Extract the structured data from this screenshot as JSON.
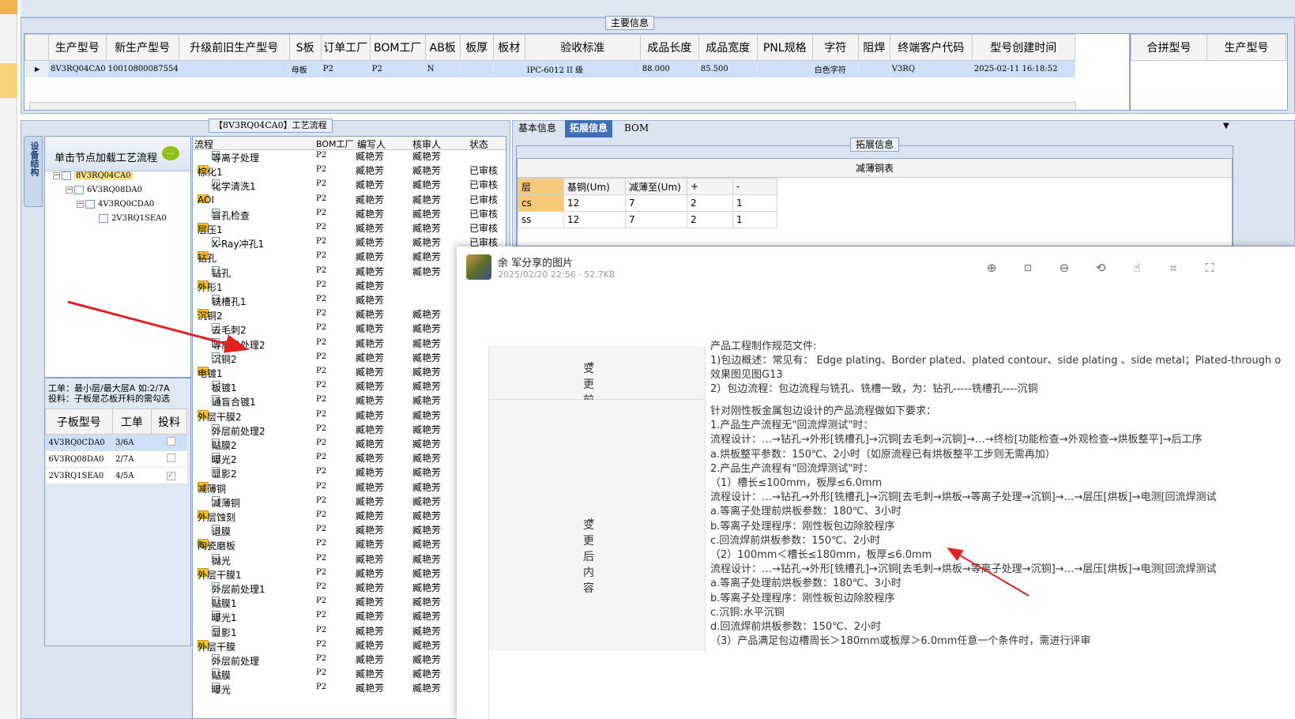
{
  "main_info": {
    "title": "主要信息",
    "columns": [
      "生产型号",
      "新生产型号",
      "升级前旧生产型号",
      "S板",
      "订单工厂",
      "BOM工厂",
      "AB板",
      "板厚",
      "板材",
      "验收标准",
      "成品长度",
      "成品宽度",
      "PNL规格",
      "字符",
      "阻焊",
      "终端客户代码",
      "型号创建时间"
    ],
    "row": [
      "8V3RQ04CA0",
      "10010800087554",
      "",
      "母板",
      "P2",
      "P2",
      "N",
      "",
      "",
      "IPC-6012 II 级",
      "88.000",
      "85.500",
      "",
      "白色字符",
      "",
      "V3RQ",
      "2025-02-11 16:18:52"
    ],
    "side_columns": [
      "合拼型号",
      "生产型号"
    ]
  },
  "process": {
    "title": "【8V3RQ04CA0】工艺流程",
    "side_tab": "设备结构",
    "tree_header": "单击节点加载工艺流程",
    "tree_nodes": [
      "8V3RQ04CA0",
      "6V3RQ08DA0",
      "4V3RQ0CDA0",
      "2V3RQ1SEA0"
    ],
    "info_line1": "工单：最小层/最大层A 如:2/7A",
    "info_line2": "投料：子板是芯板开料的需勾选",
    "sub_columns": [
      "子板型号",
      "工单",
      "投料"
    ],
    "sub_rows": [
      {
        "model": "4V3RQ0CDA0",
        "order": "3/6A",
        "checked": ""
      },
      {
        "model": "6V3RQ08DA0",
        "order": "2/7A",
        "checked": ""
      },
      {
        "model": "2V3RQ1SEA0",
        "order": "4/5A",
        "checked": "✓"
      }
    ],
    "flow_columns": [
      "流程",
      "BOM工厂",
      "编写人",
      "核审人",
      "状态"
    ],
    "flow_rows": [
      {
        "name": "等离子处理",
        "folder": false,
        "factory": "P2",
        "writer": "臧艳芳",
        "reviewer": "臧艳芳",
        "status": ""
      },
      {
        "name": "棕化1",
        "folder": true,
        "factory": "P2",
        "writer": "臧艳芳",
        "reviewer": "臧艳芳",
        "status": "已审核"
      },
      {
        "name": "化学清洗1",
        "folder": false,
        "factory": "P2",
        "writer": "臧艳芳",
        "reviewer": "臧艳芳",
        "status": "已审核"
      },
      {
        "name": "AOI",
        "folder": true,
        "factory": "P2",
        "writer": "臧艳芳",
        "reviewer": "臧艳芳",
        "status": "已审核"
      },
      {
        "name": "盲孔检查",
        "folder": false,
        "factory": "P2",
        "writer": "臧艳芳",
        "reviewer": "臧艳芳",
        "status": "已审核"
      },
      {
        "name": "层压1",
        "folder": true,
        "factory": "P2",
        "writer": "臧艳芳",
        "reviewer": "臧艳芳",
        "status": "已审核"
      },
      {
        "name": "X-Ray冲孔1",
        "folder": false,
        "factory": "P2",
        "writer": "臧艳芳",
        "reviewer": "臧艳芳",
        "status": "已审核"
      },
      {
        "name": "钻孔",
        "folder": true,
        "factory": "P2",
        "writer": "臧艳芳",
        "reviewer": "臧艳芳",
        "status": "已审核"
      },
      {
        "name": "钻孔",
        "folder": false,
        "factory": "P2",
        "writer": "臧艳芳",
        "reviewer": "臧艳芳",
        "status": "已审核"
      },
      {
        "name": "外形1",
        "folder": true,
        "factory": "P2",
        "writer": "臧艳芳",
        "reviewer": "",
        "status": ""
      },
      {
        "name": "铣槽孔1",
        "folder": false,
        "factory": "P2",
        "writer": "臧艳芳",
        "reviewer": "",
        "status": ""
      },
      {
        "name": "沉铜2",
        "folder": true,
        "factory": "P2",
        "writer": "臧艳芳",
        "reviewer": "臧艳芳",
        "status": ""
      },
      {
        "name": "去毛刺2",
        "folder": false,
        "factory": "P2",
        "writer": "臧艳芳",
        "reviewer": "臧艳芳",
        "status": ""
      },
      {
        "name": "等离子处理2",
        "folder": false,
        "factory": "P2",
        "writer": "臧艳芳",
        "reviewer": "臧艳芳",
        "status": ""
      },
      {
        "name": "沉铜2",
        "folder": false,
        "factory": "P2",
        "writer": "臧艳芳",
        "reviewer": "臧艳芳",
        "status": ""
      },
      {
        "name": "电镀1",
        "folder": true,
        "factory": "P2",
        "writer": "臧艳芳",
        "reviewer": "臧艳芳",
        "status": ""
      },
      {
        "name": "板镀1",
        "folder": false,
        "factory": "P2",
        "writer": "臧艳芳",
        "reviewer": "臧艳芳",
        "status": ""
      },
      {
        "name": "通盲合镀1",
        "folder": false,
        "factory": "P2",
        "writer": "臧艳芳",
        "reviewer": "臧艳芳",
        "status": ""
      },
      {
        "name": "外层干膜2",
        "folder": true,
        "factory": "P2",
        "writer": "臧艳芳",
        "reviewer": "臧艳芳",
        "status": ""
      },
      {
        "name": "外层前处理2",
        "folder": false,
        "factory": "P2",
        "writer": "臧艳芳",
        "reviewer": "臧艳芳",
        "status": ""
      },
      {
        "name": "贴膜2",
        "folder": false,
        "factory": "P2",
        "writer": "臧艳芳",
        "reviewer": "臧艳芳",
        "status": ""
      },
      {
        "name": "曝光2",
        "folder": false,
        "factory": "P2",
        "writer": "臧艳芳",
        "reviewer": "臧艳芳",
        "status": ""
      },
      {
        "name": "显影2",
        "folder": false,
        "factory": "P2",
        "writer": "臧艳芳",
        "reviewer": "臧艳芳",
        "status": ""
      },
      {
        "name": "减薄铜",
        "folder": true,
        "factory": "P2",
        "writer": "臧艳芳",
        "reviewer": "臧艳芳",
        "status": ""
      },
      {
        "name": "减薄铜",
        "folder": false,
        "factory": "P2",
        "writer": "臧艳芳",
        "reviewer": "臧艳芳",
        "status": ""
      },
      {
        "name": "外层蚀刻",
        "folder": true,
        "factory": "P2",
        "writer": "臧艳芳",
        "reviewer": "臧艳芳",
        "status": ""
      },
      {
        "name": "退膜",
        "folder": false,
        "factory": "P2",
        "writer": "臧艳芳",
        "reviewer": "臧艳芳",
        "status": ""
      },
      {
        "name": "陶瓷磨板",
        "folder": true,
        "factory": "P2",
        "writer": "臧艳芳",
        "reviewer": "臧艳芳",
        "status": ""
      },
      {
        "name": "抛光",
        "folder": false,
        "factory": "P2",
        "writer": "臧艳芳",
        "reviewer": "臧艳芳",
        "status": ""
      },
      {
        "name": "外层干膜1",
        "folder": true,
        "factory": "P2",
        "writer": "臧艳芳",
        "reviewer": "臧艳芳",
        "status": ""
      },
      {
        "name": "外层前处理1",
        "folder": false,
        "factory": "P2",
        "writer": "臧艳芳",
        "reviewer": "臧艳芳",
        "status": ""
      },
      {
        "name": "贴膜1",
        "folder": false,
        "factory": "P2",
        "writer": "臧艳芳",
        "reviewer": "臧艳芳",
        "status": ""
      },
      {
        "name": "曝光1",
        "folder": false,
        "factory": "P2",
        "writer": "臧艳芳",
        "reviewer": "臧艳芳",
        "status": ""
      },
      {
        "name": "显影1",
        "folder": false,
        "factory": "P2",
        "writer": "臧艳芳",
        "reviewer": "臧艳芳",
        "status": ""
      },
      {
        "name": "外层干膜",
        "folder": true,
        "factory": "P2",
        "writer": "臧艳芳",
        "reviewer": "臧艳芳",
        "status": ""
      },
      {
        "name": "外层前处理",
        "folder": false,
        "factory": "P2",
        "writer": "臧艳芳",
        "reviewer": "臧艳芳",
        "status": ""
      },
      {
        "name": "贴膜",
        "folder": false,
        "factory": "P2",
        "writer": "臧艳芳",
        "reviewer": "臧艳芳",
        "status": ""
      },
      {
        "name": "曝光",
        "folder": false,
        "factory": "P2",
        "writer": "臧艳芳",
        "reviewer": "臧艳芳",
        "status": ""
      }
    ]
  },
  "right_tabs": [
    "基本信息",
    "拓展信息",
    "BOM"
  ],
  "ext_title": "拓展信息",
  "thin_table": {
    "title": "减薄铜表",
    "headers": [
      "层",
      "基铜(Um)",
      "减薄至(Um)",
      "+",
      "-"
    ],
    "rows": [
      [
        "cs",
        "12",
        "7",
        "2",
        "1"
      ],
      [
        "ss",
        "12",
        "7",
        "2",
        "1"
      ]
    ]
  },
  "viewer": {
    "title": "余  军分享的图片",
    "meta": "2025/02/20 22:56 · 52.7KB",
    "icons": [
      "zoom-in",
      "original-size",
      "zoom-out",
      "rotate",
      "hand",
      "crop",
      "fit"
    ],
    "before_label": "变更前内容",
    "after_label": "变更后内容",
    "required_mark": "*",
    "before_lines": [
      "产品工程制作规范文件:",
      "1)包边概述：常见有： Edge plating、Border plated、plated contour、side plating 、side metal；Plated-through o",
      "效果图见图G13",
      "2）包边流程：包边流程与铣孔、铣槽一致，为：钻孔-----铣槽孔----沉铜"
    ],
    "after_lines": [
      "针对刚性板金属包边设计的产品流程做如下要求：",
      "1.产品生产流程无\"回流焊测试\"时：",
      "流程设计：…→钻孔→外形[铣槽孔]→沉铜[去毛刺→沉铜]→…→终检[功能检查→外观检查→烘板整平]→后工序",
      "  a.烘板整平参数：150℃、2小时（如原流程已有烘板整平工步则无需再加）",
      "2.产品生产流程有\"回流焊测试\"时：",
      "（1）槽长≤100mm，板厚≤6.0mm",
      " 流程设计：…→钻孔→外形[铣槽孔]→沉铜[去毛刺→烘板→等离子处理→沉铜]→…→层压[烘板]→电测[回流焊测试",
      "  a.等离子处理前烘板参数：180℃、3小时",
      "  b.等离子处理程序：刚性板包边除胶程序",
      "  c.回流焊前烘板参数：150℃、2小时",
      "（2）100mm＜槽长≤180mm，板厚≤6.0mm",
      "流程设计：…→钻孔→外形[铣槽孔]→沉铜[去毛刺→烘板→等离子处理→沉铜]→…→层压[烘板]→电测[回流焊测试",
      "  a.等离子处理前烘板参数：180℃、3小时",
      "  b.等离子处理程序：刚性板包边除胶程序",
      "  c.沉铜:水平沉铜",
      "  d.回流焊前烘板参数：150℃、2小时",
      "（3）产品满足包边槽周长＞180mm或板厚＞6.0mm任意一个条件时，需进行评审"
    ]
  },
  "colors": {
    "arrow": "#e32020",
    "selection": "#cde0f7",
    "accent": "#3f6fb5"
  }
}
